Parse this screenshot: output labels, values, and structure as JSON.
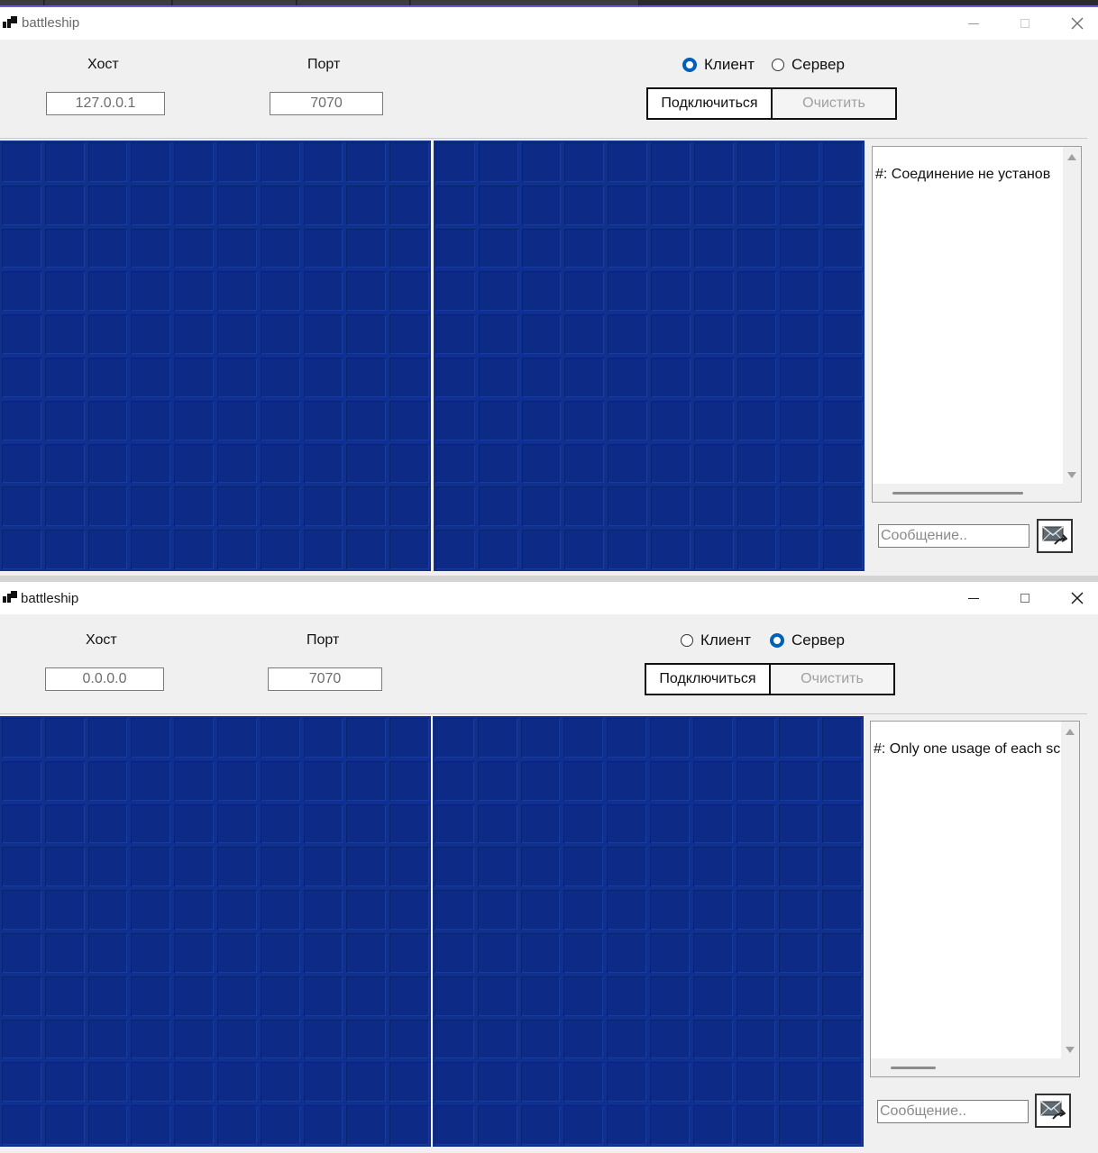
{
  "windows": [
    {
      "title": "battleship",
      "host_label": "Хост",
      "host_value": "127.0.0.1",
      "port_label": "Порт",
      "port_value": "7070",
      "radio_client_label": "Клиент",
      "radio_server_label": "Сервер",
      "selected_mode": "client",
      "connect_label": "Подключиться",
      "clear_label": "Очистить",
      "log_text": "#: Соединение не установ",
      "message_placeholder": "Сообщение..",
      "send_icon": "envelope-arrow-icon"
    },
    {
      "title": "battleship",
      "host_label": "Хост",
      "host_value": "0.0.0.0",
      "port_label": "Порт",
      "port_value": "7070",
      "radio_client_label": "Клиент",
      "radio_server_label": "Сервер",
      "selected_mode": "server",
      "connect_label": "Подключиться",
      "clear_label": "Очистить",
      "log_text": "#: Only one usage of each sc",
      "message_placeholder": "Сообщение..",
      "send_icon": "envelope-arrow-icon"
    }
  ],
  "colors": {
    "board_water": "#0c2a86",
    "radio_selected": "#005fb8"
  }
}
